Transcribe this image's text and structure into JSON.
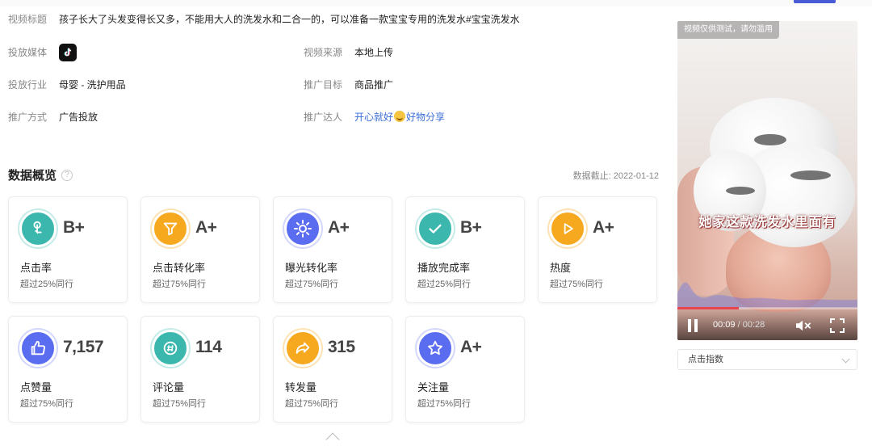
{
  "info": {
    "title_label": "视频标题",
    "title_value": "孩子长大了头发变得长又多，不能用大人的洗发水和二合一的，可以准备一款宝宝专用的洗发水#宝宝洗发水",
    "media_label": "投放媒体",
    "media_icon": "tiktok-icon",
    "source_label": "视频来源",
    "source_value": "本地上传",
    "industry_label": "投放行业",
    "industry_value": "母婴 - 洗护用品",
    "goal_label": "推广目标",
    "goal_value": "商品推广",
    "method_label": "推广方式",
    "method_value": "广告投放",
    "talent_label": "推广达人",
    "talent_value_a": "开心就好",
    "talent_value_b": "好物分享"
  },
  "overview": {
    "title": "数据概览",
    "help": "?",
    "date": "数据截止: 2022-01-12"
  },
  "cards": [
    {
      "icon": "touch-icon",
      "color": "teal",
      "value": "B+",
      "name": "点击率",
      "sub": "超过25%同行"
    },
    {
      "icon": "funnel-icon",
      "color": "orange",
      "value": "A+",
      "name": "点击转化率",
      "sub": "超过75%同行"
    },
    {
      "icon": "sun-icon",
      "color": "blue",
      "value": "A+",
      "name": "曝光转化率",
      "sub": "超过75%同行"
    },
    {
      "icon": "check-icon",
      "color": "teal",
      "value": "B+",
      "name": "播放完成率",
      "sub": "超过25%同行"
    },
    {
      "icon": "play-icon",
      "color": "orange",
      "value": "A+",
      "name": "热度",
      "sub": "超过75%同行"
    },
    {
      "icon": "thumbs-up-icon",
      "color": "blue",
      "value": "7,157",
      "name": "点赞量",
      "sub": "超过75%同行"
    },
    {
      "icon": "comment-icon",
      "color": "teal",
      "value": "114",
      "name": "评论量",
      "sub": "超过75%同行"
    },
    {
      "icon": "share-icon",
      "color": "orange",
      "value": "315",
      "name": "转发量",
      "sub": "超过75%同行"
    },
    {
      "icon": "star-icon",
      "color": "blue",
      "value": "A+",
      "name": "关注量",
      "sub": "超过75%同行"
    }
  ],
  "video": {
    "watermark": "视频仅供测试，请勿滥用",
    "subtitle": "她家这款洗发水里面有",
    "current_time": "00:09",
    "separator": " / ",
    "total_time": "00:28",
    "progress": 0.34
  },
  "metric_select": {
    "value": "点击指数"
  },
  "colors": {
    "teal": "#3cb7ad",
    "orange": "#f6a81f",
    "blue": "#5a6cf0",
    "link": "#3d6fd8",
    "progress": "#e8464f"
  }
}
